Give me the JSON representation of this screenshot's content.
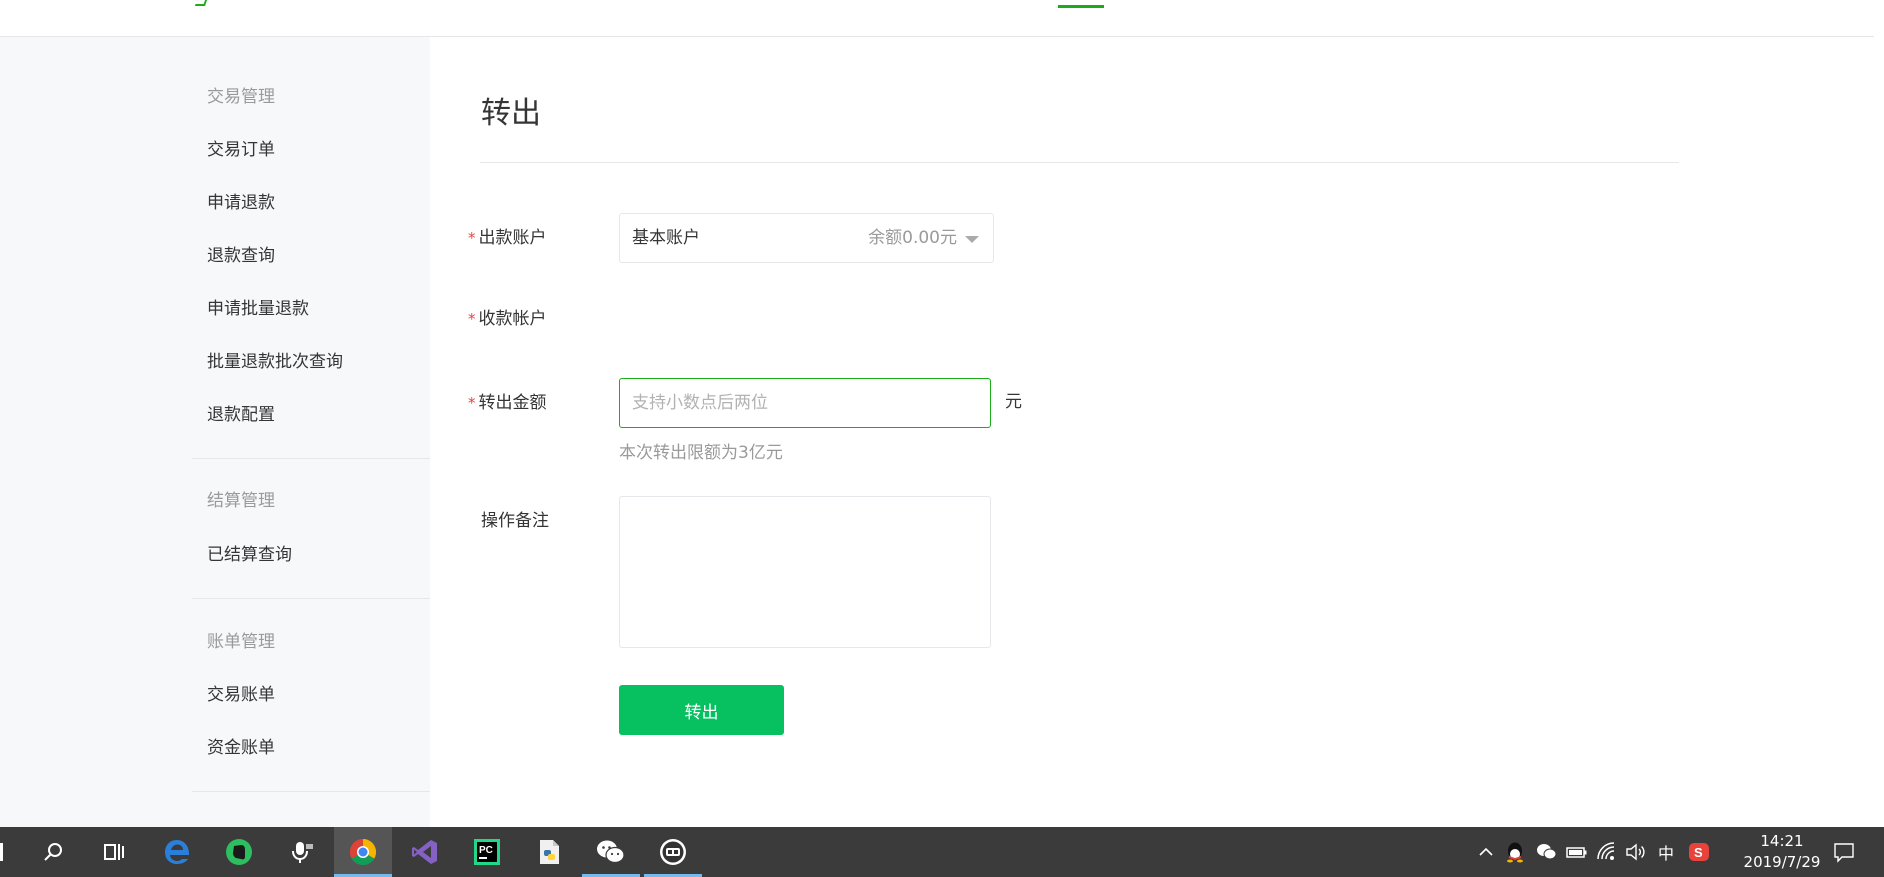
{
  "sidebar": {
    "groups": [
      {
        "title": "交易管理",
        "items": [
          {
            "label": "交易订单"
          },
          {
            "label": "申请退款"
          },
          {
            "label": "退款查询"
          },
          {
            "label": "申请批量退款"
          },
          {
            "label": "批量退款批次查询"
          },
          {
            "label": "退款配置"
          }
        ]
      },
      {
        "title": "结算管理",
        "items": [
          {
            "label": "已结算查询"
          }
        ]
      },
      {
        "title": "账单管理",
        "items": [
          {
            "label": "交易账单"
          },
          {
            "label": "资金账单"
          }
        ]
      }
    ]
  },
  "main": {
    "title": "转出",
    "form": {
      "required_mark": "*",
      "payer_account": {
        "label": "出款账户",
        "selected_name": "基本账户",
        "balance": "余额0.00元"
      },
      "payee_account": {
        "label": "收款帐户"
      },
      "amount": {
        "label": "转出金额",
        "placeholder": "支持小数点后两位",
        "value": "",
        "unit": "元",
        "tip": "本次转出限额为3亿元"
      },
      "remark": {
        "label": "操作备注",
        "value": ""
      },
      "submit_label": "转出"
    }
  },
  "taskbar": {
    "apps": [
      {
        "name": "search-icon"
      },
      {
        "name": "task-view-icon"
      },
      {
        "name": "edge-icon"
      },
      {
        "name": "evernote-icon"
      },
      {
        "name": "voice-assistant-icon"
      },
      {
        "name": "chrome-icon"
      },
      {
        "name": "visual-studio-icon"
      },
      {
        "name": "pycharm-icon"
      },
      {
        "name": "python-file-icon"
      },
      {
        "name": "wechat-icon"
      },
      {
        "name": "game-client-icon"
      }
    ],
    "pycharm_badge": "PC",
    "tray": {
      "ime": "中",
      "sogou": "S",
      "time": "14:21",
      "date": "2019/7/29"
    }
  },
  "colors": {
    "brand_green": "#1aad19",
    "button_green": "#07c160",
    "required_red": "#e64340",
    "sidebar_bg": "#f6f8f9",
    "taskbar_bg": "#3b3b3b"
  }
}
